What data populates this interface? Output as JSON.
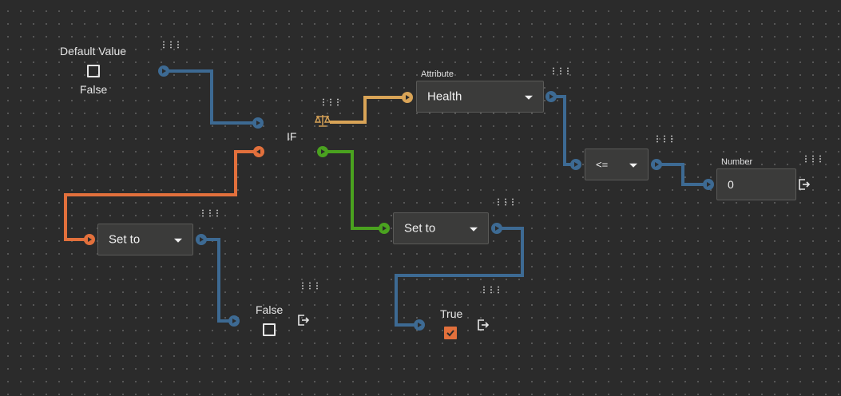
{
  "default_node": {
    "label": "Default Value",
    "value_text": "False",
    "checked": false
  },
  "if_node": {
    "label": "IF"
  },
  "attribute_node": {
    "label": "Attribute",
    "selected": "Health"
  },
  "compare_node": {
    "selected": "<="
  },
  "number_node": {
    "label": "Number",
    "value": "0"
  },
  "set_to_left": {
    "selected": "Set to"
  },
  "set_to_right": {
    "selected": "Set to"
  },
  "false_output": {
    "label": "False",
    "checked": false
  },
  "true_output": {
    "label": "True",
    "checked": true
  },
  "icons": {
    "menu": "drag-handle-dots",
    "exit": "exit-arrow",
    "scale": "balance-scale",
    "check": "checkmark"
  },
  "colors": {
    "blue": "#3d6a93",
    "orange": "#e2703c",
    "green": "#4aa21f",
    "gold": "#d9a457",
    "background": "#2b2b2b"
  }
}
